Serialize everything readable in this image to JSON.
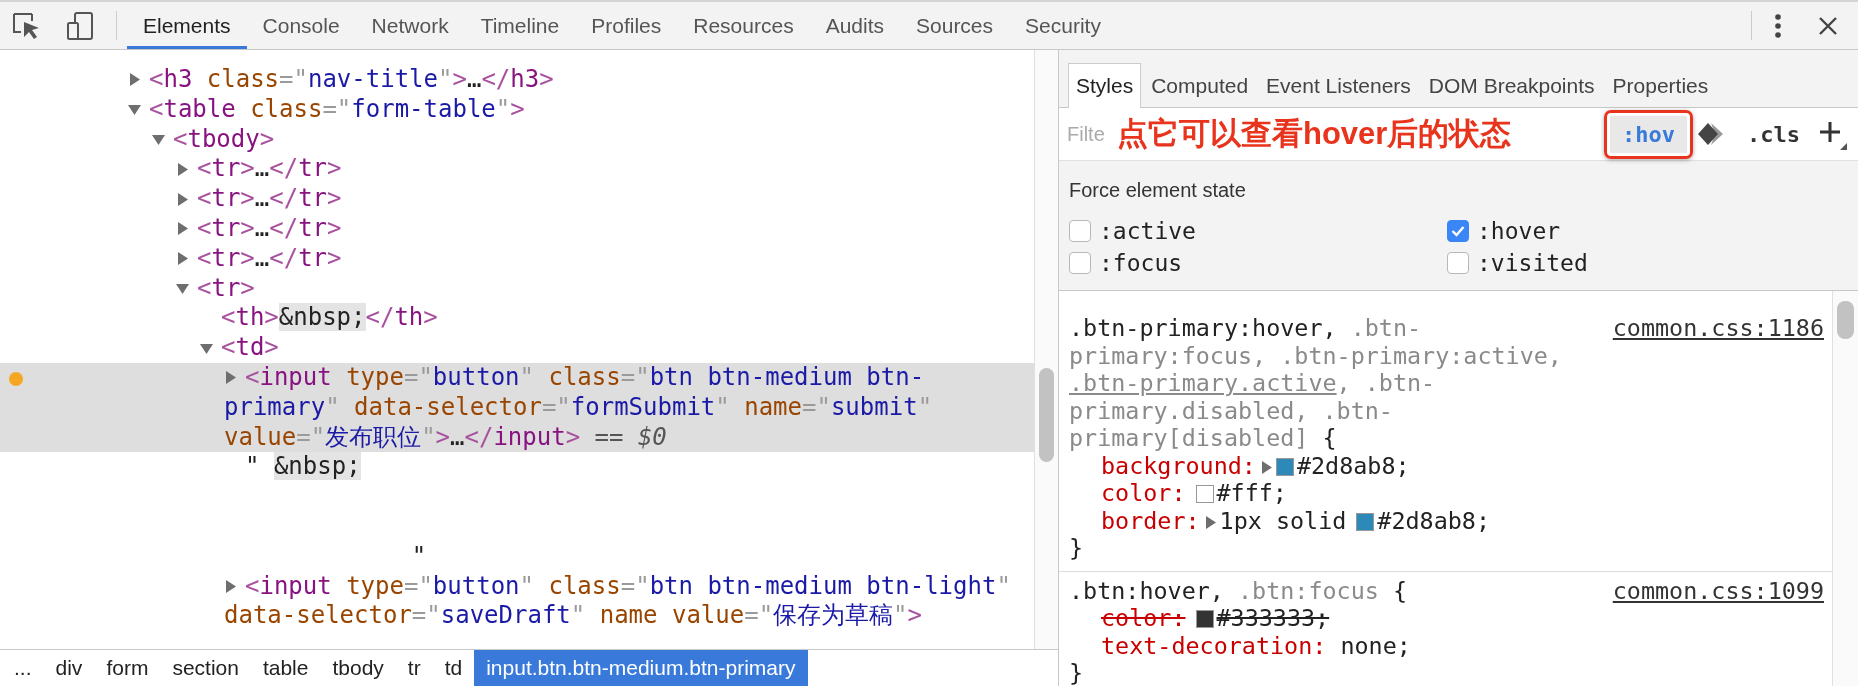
{
  "main_tabs": [
    {
      "label": "Elements",
      "selected": true
    },
    {
      "label": "Console",
      "selected": false
    },
    {
      "label": "Network",
      "selected": false
    },
    {
      "label": "Timeline",
      "selected": false
    },
    {
      "label": "Profiles",
      "selected": false
    },
    {
      "label": "Resources",
      "selected": false
    },
    {
      "label": "Audits",
      "selected": false
    },
    {
      "label": "Sources",
      "selected": false
    },
    {
      "label": "Security",
      "selected": false
    }
  ],
  "dom_tree": [
    {
      "tokens": [
        {
          "kind": "bracket",
          "text": "<"
        },
        {
          "kind": "tag",
          "text": "h3"
        },
        {
          "kind": "attr",
          "text": " class"
        },
        {
          "kind": "punct",
          "text": "=\""
        },
        {
          "kind": "value",
          "text": "nav-title"
        },
        {
          "kind": "punct",
          "text": "\""
        },
        {
          "kind": "bracket",
          "text": ">"
        },
        {
          "kind": "text",
          "text": "…"
        },
        {
          "kind": "bracket",
          "text": "</"
        },
        {
          "kind": "tag",
          "text": "h3"
        },
        {
          "kind": "bracket",
          "text": ">"
        }
      ],
      "expanded": false,
      "selected": false,
      "breakpoint": false
    },
    {
      "tokens": [
        {
          "kind": "bracket",
          "text": "<"
        },
        {
          "kind": "tag",
          "text": "table"
        },
        {
          "kind": "attr",
          "text": " class"
        },
        {
          "kind": "punct",
          "text": "=\""
        },
        {
          "kind": "value",
          "text": "form-table"
        },
        {
          "kind": "punct",
          "text": "\""
        },
        {
          "kind": "bracket",
          "text": ">"
        }
      ],
      "expanded": true,
      "selected": false,
      "breakpoint": false,
      "children": [
        {
          "tokens": [
            {
              "kind": "bracket",
              "text": "<"
            },
            {
              "kind": "tag",
              "text": "tbody"
            },
            {
              "kind": "bracket",
              "text": ">"
            }
          ],
          "expanded": true,
          "selected": false,
          "breakpoint": false,
          "children": [
            {
              "tokens": [
                {
                  "kind": "bracket",
                  "text": "<"
                },
                {
                  "kind": "tag",
                  "text": "tr"
                },
                {
                  "kind": "bracket",
                  "text": ">"
                },
                {
                  "kind": "text",
                  "text": "…"
                },
                {
                  "kind": "bracket",
                  "text": "</"
                },
                {
                  "kind": "tag",
                  "text": "tr"
                },
                {
                  "kind": "bracket",
                  "text": ">"
                }
              ],
              "expanded": false,
              "selected": false,
              "breakpoint": false
            },
            {
              "tokens": [
                {
                  "kind": "bracket",
                  "text": "<"
                },
                {
                  "kind": "tag",
                  "text": "tr"
                },
                {
                  "kind": "bracket",
                  "text": ">"
                },
                {
                  "kind": "text",
                  "text": "…"
                },
                {
                  "kind": "bracket",
                  "text": "</"
                },
                {
                  "kind": "tag",
                  "text": "tr"
                },
                {
                  "kind": "bracket",
                  "text": ">"
                }
              ],
              "expanded": false,
              "selected": false,
              "breakpoint": false
            },
            {
              "tokens": [
                {
                  "kind": "bracket",
                  "text": "<"
                },
                {
                  "kind": "tag",
                  "text": "tr"
                },
                {
                  "kind": "bracket",
                  "text": ">"
                },
                {
                  "kind": "text",
                  "text": "…"
                },
                {
                  "kind": "bracket",
                  "text": "</"
                },
                {
                  "kind": "tag",
                  "text": "tr"
                },
                {
                  "kind": "bracket",
                  "text": ">"
                }
              ],
              "expanded": false,
              "selected": false,
              "breakpoint": false
            },
            {
              "tokens": [
                {
                  "kind": "bracket",
                  "text": "<"
                },
                {
                  "kind": "tag",
                  "text": "tr"
                },
                {
                  "kind": "bracket",
                  "text": ">"
                },
                {
                  "kind": "text",
                  "text": "…"
                },
                {
                  "kind": "bracket",
                  "text": "</"
                },
                {
                  "kind": "tag",
                  "text": "tr"
                },
                {
                  "kind": "bracket",
                  "text": ">"
                }
              ],
              "expanded": false,
              "selected": false,
              "breakpoint": false
            },
            {
              "tokens": [
                {
                  "kind": "bracket",
                  "text": "<"
                },
                {
                  "kind": "tag",
                  "text": "tr"
                },
                {
                  "kind": "bracket",
                  "text": ">"
                }
              ],
              "expanded": true,
              "selected": false,
              "breakpoint": false,
              "children": [
                {
                  "tokens": [
                    {
                      "kind": "bracket",
                      "text": "<"
                    },
                    {
                      "kind": "tag",
                      "text": "th"
                    },
                    {
                      "kind": "bracket",
                      "text": ">"
                    },
                    {
                      "kind": "entity",
                      "text": "&nbsp;"
                    },
                    {
                      "kind": "bracket",
                      "text": "</"
                    },
                    {
                      "kind": "tag",
                      "text": "th"
                    },
                    {
                      "kind": "bracket",
                      "text": ">"
                    }
                  ],
                  "selected": false,
                  "breakpoint": false
                },
                {
                  "tokens": [
                    {
                      "kind": "bracket",
                      "text": "<"
                    },
                    {
                      "kind": "tag",
                      "text": "td"
                    },
                    {
                      "kind": "bracket",
                      "text": ">"
                    }
                  ],
                  "expanded": true,
                  "selected": false,
                  "breakpoint": false,
                  "children": [
                    {
                      "tokens": [
                        {
                          "kind": "bracket",
                          "text": "<"
                        },
                        {
                          "kind": "tag",
                          "text": "input"
                        },
                        {
                          "kind": "attr",
                          "text": " type"
                        },
                        {
                          "kind": "punct",
                          "text": "=\""
                        },
                        {
                          "kind": "value",
                          "text": "button"
                        },
                        {
                          "kind": "punct",
                          "text": "\""
                        },
                        {
                          "kind": "attr",
                          "text": " class"
                        },
                        {
                          "kind": "punct",
                          "text": "=\""
                        },
                        {
                          "kind": "value",
                          "text": "btn btn-medium btn-primary"
                        },
                        {
                          "kind": "punct",
                          "text": "\""
                        },
                        {
                          "kind": "attr",
                          "text": " data-selector"
                        },
                        {
                          "kind": "punct",
                          "text": "=\""
                        },
                        {
                          "kind": "value",
                          "text": "formSubmit"
                        },
                        {
                          "kind": "punct",
                          "text": "\""
                        },
                        {
                          "kind": "attr",
                          "text": " name"
                        },
                        {
                          "kind": "punct",
                          "text": "=\""
                        },
                        {
                          "kind": "value",
                          "text": "submit"
                        },
                        {
                          "kind": "punct",
                          "text": "\""
                        },
                        {
                          "kind": "attr",
                          "text": " value"
                        },
                        {
                          "kind": "punct",
                          "text": "=\""
                        },
                        {
                          "kind": "value",
                          "text": "发布职位"
                        },
                        {
                          "kind": "punct",
                          "text": "\""
                        },
                        {
                          "kind": "bracket",
                          "text": ">"
                        },
                        {
                          "kind": "text",
                          "text": "…"
                        },
                        {
                          "kind": "bracket",
                          "text": "</"
                        },
                        {
                          "kind": "tag",
                          "text": "input"
                        },
                        {
                          "kind": "bracket",
                          "text": ">"
                        },
                        {
                          "kind": "hint",
                          "text": " == "
                        },
                        {
                          "kind": "var",
                          "text": "$0"
                        }
                      ],
                      "expanded": false,
                      "selected": true,
                      "breakpoint": true
                    },
                    {
                      "tokens": [
                        {
                          "kind": "text",
                          "text": "\" "
                        },
                        {
                          "kind": "entity",
                          "text": "&nbsp;"
                        },
                        {
                          "kind": "text",
                          "text": "\n\n\n             \""
                        }
                      ],
                      "selected": false,
                      "breakpoint": false
                    },
                    {
                      "tokens": [
                        {
                          "kind": "bracket",
                          "text": "<"
                        },
                        {
                          "kind": "tag",
                          "text": "input"
                        },
                        {
                          "kind": "attr",
                          "text": " type"
                        },
                        {
                          "kind": "punct",
                          "text": "=\""
                        },
                        {
                          "kind": "value",
                          "text": "button"
                        },
                        {
                          "kind": "punct",
                          "text": "\""
                        },
                        {
                          "kind": "attr",
                          "text": " class"
                        },
                        {
                          "kind": "punct",
                          "text": "=\""
                        },
                        {
                          "kind": "value",
                          "text": "btn btn-medium btn-light"
                        },
                        {
                          "kind": "punct",
                          "text": "\""
                        },
                        {
                          "kind": "attr",
                          "text": " data-selector"
                        },
                        {
                          "kind": "punct",
                          "text": "=\""
                        },
                        {
                          "kind": "value",
                          "text": "saveDraft"
                        },
                        {
                          "kind": "punct",
                          "text": "\""
                        },
                        {
                          "kind": "attr",
                          "text": " name"
                        },
                        {
                          "kind": "attr",
                          "text": " value"
                        },
                        {
                          "kind": "punct",
                          "text": "=\""
                        },
                        {
                          "kind": "value",
                          "text": "保存为草稿"
                        },
                        {
                          "kind": "punct",
                          "text": "\""
                        },
                        {
                          "kind": "bracket",
                          "text": ">"
                        }
                      ],
                      "expanded": false,
                      "selected": false,
                      "breakpoint": false
                    }
                  ]
                }
              ]
            }
          ]
        }
      ]
    }
  ],
  "breadcrumbs": [
    {
      "label": "...",
      "selected": false
    },
    {
      "label": "div",
      "selected": false
    },
    {
      "label": "form",
      "selected": false
    },
    {
      "label": "section",
      "selected": false
    },
    {
      "label": "table",
      "selected": false
    },
    {
      "label": "tbody",
      "selected": false
    },
    {
      "label": "tr",
      "selected": false
    },
    {
      "label": "td",
      "selected": false
    },
    {
      "label": "input.btn.btn-medium.btn-primary",
      "selected": true
    }
  ],
  "sidebar_tabs": [
    {
      "label": "Styles",
      "selected": true
    },
    {
      "label": "Computed",
      "selected": false
    },
    {
      "label": "Event Listeners",
      "selected": false
    },
    {
      "label": "DOM Breakpoints",
      "selected": false
    },
    {
      "label": "Properties",
      "selected": false
    }
  ],
  "styles_toolbar": {
    "filter_placeholder": "Filte",
    "annotation": "点它可以查看hover后的状态",
    "hov_button": ":hov",
    "cls_button": ".cls"
  },
  "force_state": {
    "title": "Force element state",
    "states": [
      {
        "label": ":active",
        "checked": false
      },
      {
        "label": ":hover",
        "checked": true
      },
      {
        "label": ":focus",
        "checked": false
      },
      {
        "label": ":visited",
        "checked": false
      }
    ]
  },
  "rules": [
    {
      "source": "common.css:1186",
      "selectors": [
        {
          "text": ".btn-primary:hover, ",
          "matched": true,
          "underlined": false
        },
        {
          "text": ".btn-primary:focus, ",
          "matched": false,
          "underlined": false
        },
        {
          "text": ".btn-primary:active, ",
          "matched": false,
          "underlined": false
        },
        {
          "text": ".btn-primary.active",
          "matched": false,
          "underlined": true
        },
        {
          "text": ", .btn-primary.disabled, ",
          "matched": false,
          "underlined": false
        },
        {
          "text": ".btn-primary[disabled]",
          "matched": false,
          "underlined": false
        }
      ],
      "open_brace": " {",
      "close_brace": "}",
      "properties": [
        {
          "name": "background:",
          "expandable": true,
          "overridden": false,
          "value": [
            {
              "kind": "swatch",
              "color": "#2d8ab8"
            },
            {
              "kind": "text",
              "text": "#2d8ab8;"
            }
          ]
        },
        {
          "name": "color:",
          "expandable": false,
          "overridden": false,
          "value": [
            {
              "kind": "swatch",
              "color": "#ffffff"
            },
            {
              "kind": "text",
              "text": "#fff;"
            }
          ]
        },
        {
          "name": "border:",
          "expandable": true,
          "overridden": false,
          "value": [
            {
              "kind": "text",
              "text": "1px solid"
            },
            {
              "kind": "swatch",
              "color": "#2d8ab8"
            },
            {
              "kind": "text",
              "text": "#2d8ab8;"
            }
          ]
        }
      ]
    },
    {
      "source": "common.css:1099",
      "selectors": [
        {
          "text": ".btn:hover, ",
          "matched": true,
          "underlined": false
        },
        {
          "text": ".btn:focus",
          "matched": false,
          "underlined": false
        }
      ],
      "open_brace": " {",
      "close_brace": "}",
      "properties": [
        {
          "name": "color:",
          "expandable": false,
          "overridden": true,
          "value": [
            {
              "kind": "swatch",
              "color": "#333333"
            },
            {
              "kind": "text",
              "text": "#333333;"
            }
          ]
        },
        {
          "name": "text-decoration:",
          "expandable": false,
          "overridden": false,
          "value": [
            {
              "kind": "text",
              "text": "none;"
            }
          ]
        }
      ]
    }
  ]
}
